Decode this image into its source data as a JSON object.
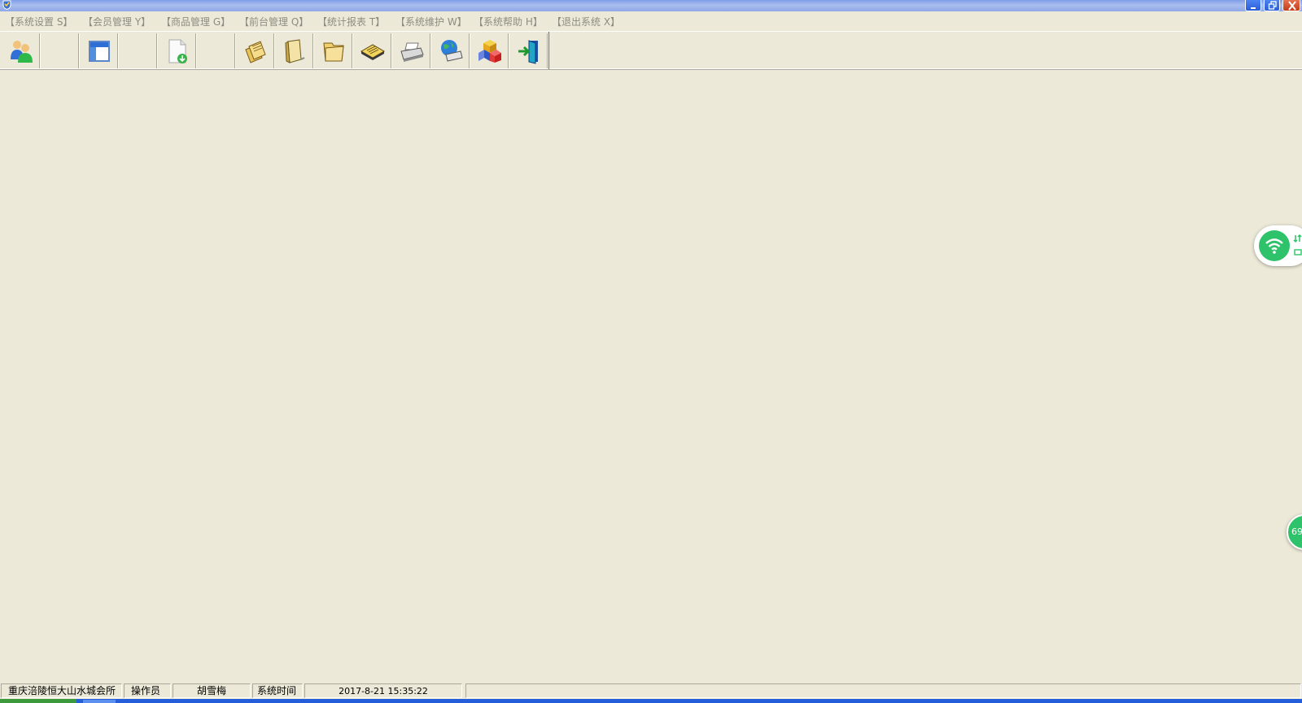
{
  "window": {
    "icons": {
      "app": "app-shield-icon",
      "minimize": "minimize-icon",
      "maximize": "restore-icon",
      "close": "close-icon"
    }
  },
  "menu": {
    "items": [
      {
        "label": "【系统设置 S】"
      },
      {
        "label": "【会员管理 Y】"
      },
      {
        "label": "【商品管理 G】"
      },
      {
        "label": "【前台管理 Q】"
      },
      {
        "label": "【统计报表 T】"
      },
      {
        "label": "【系统维护 W】"
      },
      {
        "label": "【系统帮助 H】"
      },
      {
        "label": "【退出系统 X】"
      }
    ],
    "disabled_color": "#8e8c80"
  },
  "toolbar": {
    "buttons": [
      {
        "icon": "members-icon"
      },
      {
        "icon": "blank"
      },
      {
        "icon": "window-icon"
      },
      {
        "icon": "blank"
      },
      {
        "icon": "document-download-icon"
      },
      {
        "icon": "blank"
      },
      {
        "icon": "folders-icon"
      },
      {
        "icon": "book-icon"
      },
      {
        "icon": "folder-icon"
      },
      {
        "icon": "ledger-icon"
      },
      {
        "icon": "printer-icon"
      },
      {
        "icon": "network-globe-icon"
      },
      {
        "icon": "cubes-icon"
      },
      {
        "icon": "exit-door-icon"
      }
    ]
  },
  "widgets": {
    "network": {
      "icon": "wifi-icon",
      "color": "#2ec26a"
    },
    "ball": {
      "text": "69"
    }
  },
  "statusbar": {
    "company": "重庆涪陵恒大山水城会所",
    "operator_label": "操作员",
    "operator_name": "胡雪梅",
    "time_label": "系统时间",
    "time_value": "2017-8-21 15:35:22",
    "extra": ""
  },
  "colors": {
    "background": "#ece9d8",
    "titlebar": "#8fa7e8",
    "taskbar": "#245edb"
  }
}
